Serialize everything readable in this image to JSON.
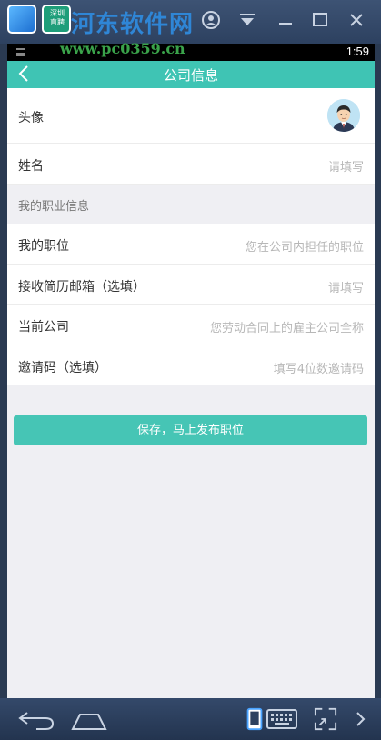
{
  "emulator": {
    "watermark_title": "河东软件网",
    "watermark_url": "www.pc0359.cn",
    "app_icon_b_text": "深圳\n直聘"
  },
  "status_bar": {
    "time": "1:59"
  },
  "header": {
    "title": "公司信息"
  },
  "profile": {
    "avatar_label": "头像",
    "name_label": "姓名",
    "name_placeholder": "请填写"
  },
  "career": {
    "section_title": "我的职业信息",
    "fields": [
      {
        "label": "我的职位",
        "placeholder": "您在公司内担任的职位"
      },
      {
        "label": "接收简历邮箱（选填）",
        "placeholder": "请填写"
      },
      {
        "label": "当前公司",
        "placeholder": "您劳动合同上的雇主公司全称"
      },
      {
        "label": "邀请码（选填）",
        "placeholder": "填写4位数邀请码"
      }
    ]
  },
  "actions": {
    "save_label": "保存，马上发布职位"
  },
  "colors": {
    "accent": "#3fc4b4",
    "button": "#46c5b5",
    "background": "#efeff3"
  }
}
